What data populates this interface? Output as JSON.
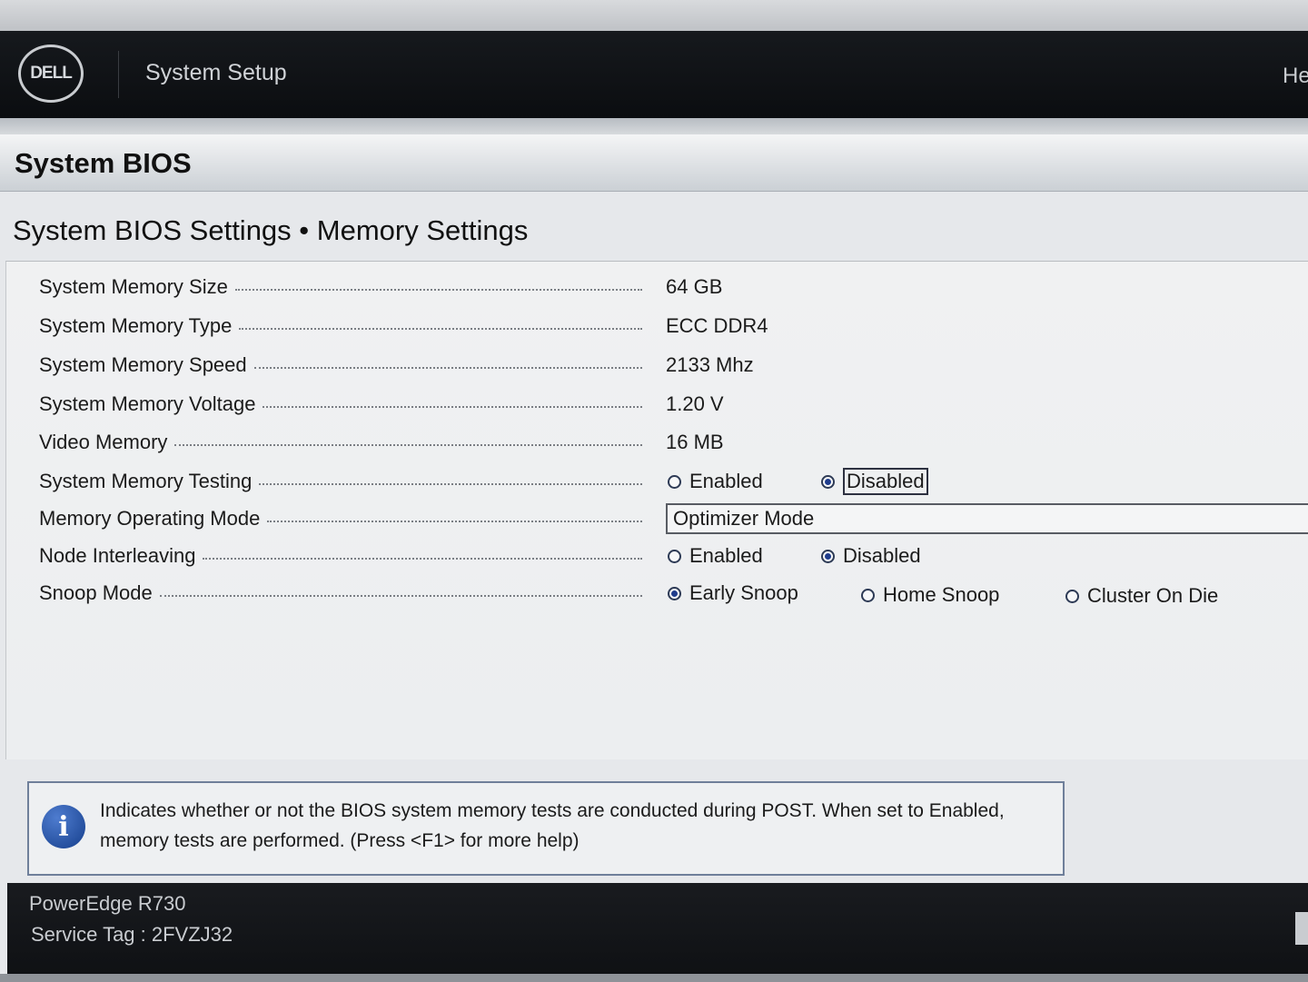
{
  "header": {
    "logo_text": "DELL",
    "app_title": "System Setup",
    "help_link": "Hel"
  },
  "section": {
    "title": "System BIOS"
  },
  "page": {
    "title": "System BIOS Settings • Memory Settings"
  },
  "settings": [
    {
      "label": "System Memory Size",
      "value": "64 GB"
    },
    {
      "label": "System Memory Type",
      "value": "ECC DDR4"
    },
    {
      "label": "System Memory Speed",
      "value": "2133 Mhz"
    },
    {
      "label": "System Memory Voltage",
      "value": "1.20 V"
    },
    {
      "label": "Video Memory",
      "value": "16 MB"
    },
    {
      "label": "System Memory Testing",
      "options": [
        "Enabled",
        "Disabled"
      ],
      "selected": "Disabled"
    },
    {
      "label": "Memory Operating Mode",
      "value": "Optimizer Mode"
    },
    {
      "label": "Node Interleaving",
      "options": [
        "Enabled",
        "Disabled"
      ],
      "selected": "Disabled"
    },
    {
      "label": "Snoop Mode",
      "options": [
        "Early Snoop",
        "Home Snoop",
        "Cluster On Die"
      ],
      "selected": "Early Snoop"
    }
  ],
  "help": {
    "icon": "info-icon",
    "text": "Indicates whether or not the BIOS system memory tests are conducted during POST. When set to Enabled, memory tests are performed. (Press <F1> for more help)"
  },
  "footer": {
    "model": "PowerEdge R730",
    "service_tag": "Service Tag : 2FVZJ32"
  },
  "colors": {
    "topbar": "#111418",
    "radio_fill": "#1f3c8c",
    "help_border": "#6f7f9a"
  }
}
